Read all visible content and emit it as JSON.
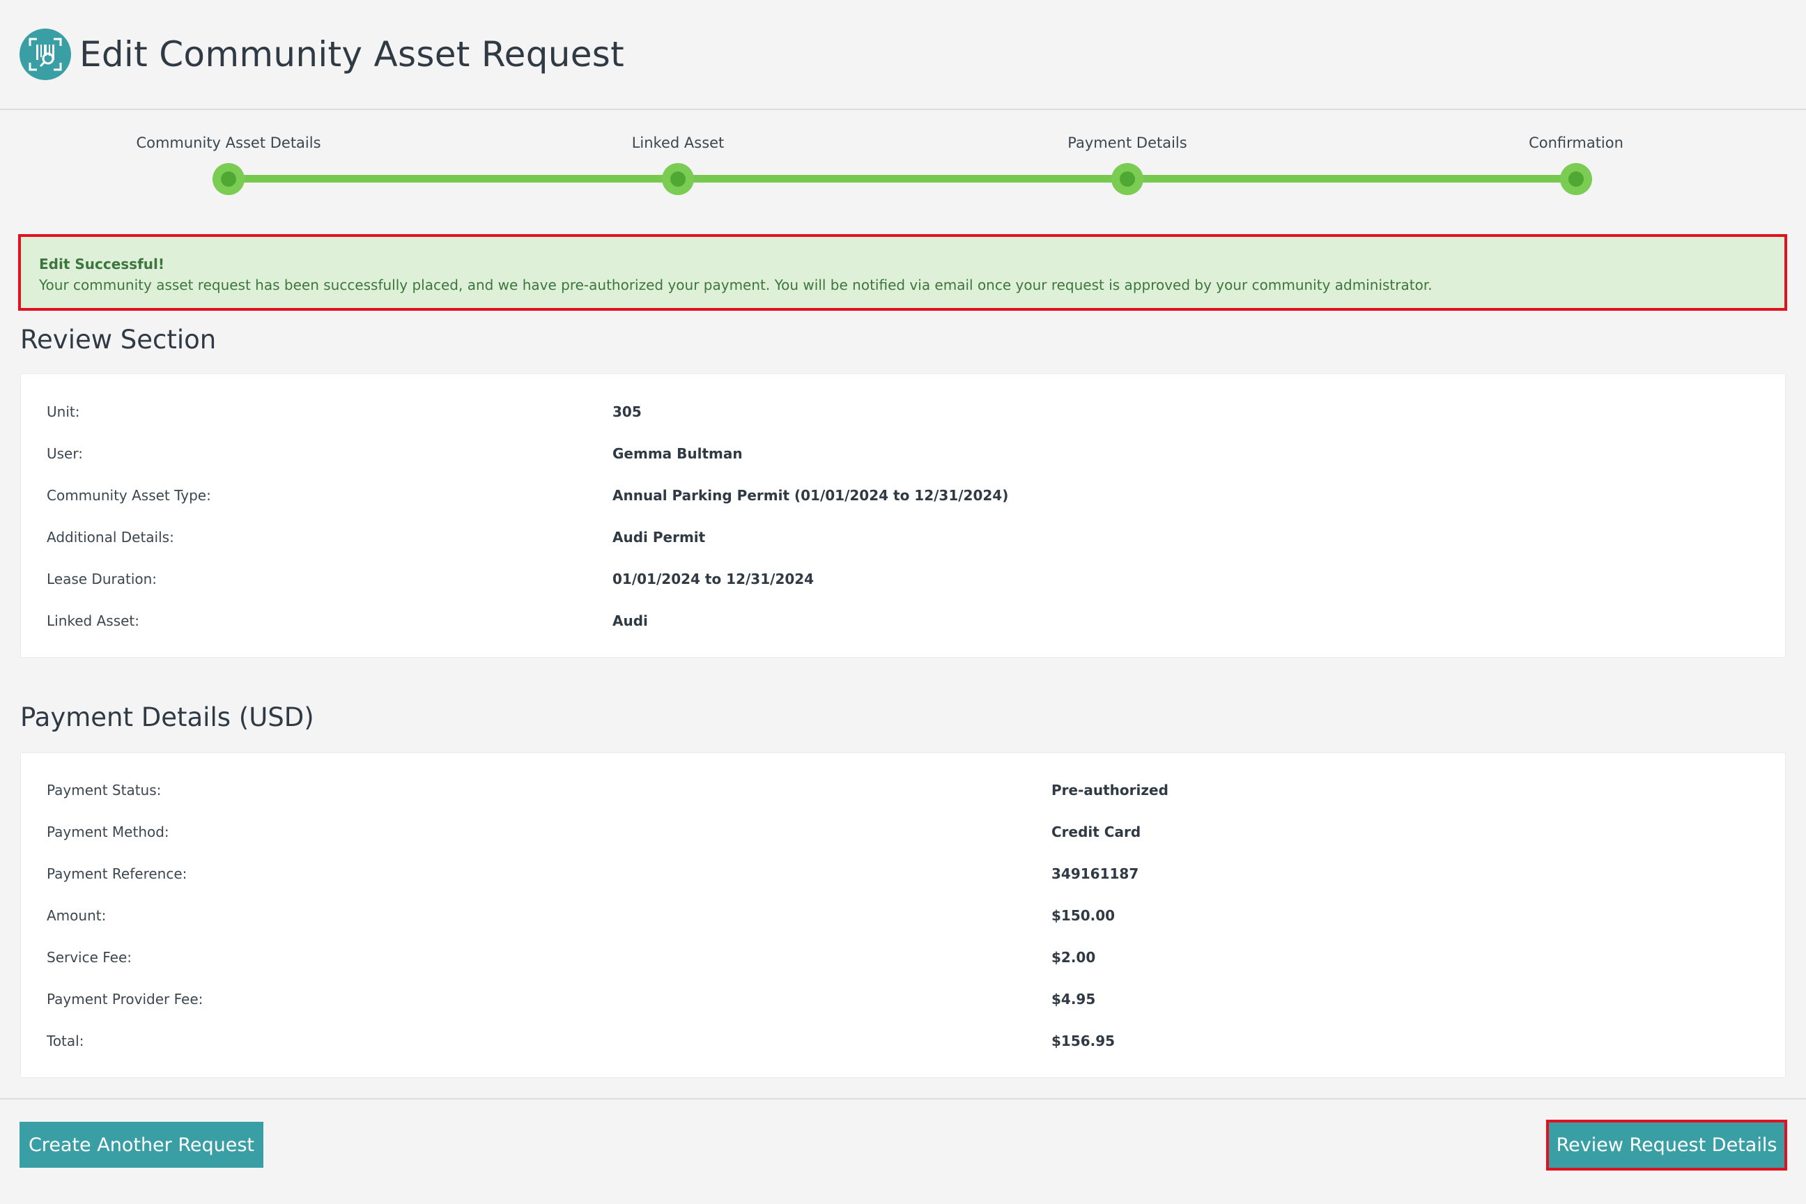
{
  "header": {
    "title": "Edit Community Asset Request",
    "logo_icon": "barcode-scan-icon"
  },
  "stepper": {
    "steps": [
      {
        "label": "Community Asset Details"
      },
      {
        "label": "Linked Asset"
      },
      {
        "label": "Payment Details"
      },
      {
        "label": "Confirmation"
      }
    ],
    "color": "#76c84f"
  },
  "alert": {
    "title": "Edit Successful!",
    "message": "Your community asset request has been successfully placed, and we have pre-authorized your payment. You will be notified via email once your request is approved by your community administrator."
  },
  "review": {
    "title": "Review Section",
    "rows": [
      {
        "label": "Unit:",
        "value": "305"
      },
      {
        "label": "User:",
        "value": "Gemma Bultman"
      },
      {
        "label": "Community Asset Type:",
        "value": "Annual Parking Permit (01/01/2024 to 12/31/2024)"
      },
      {
        "label": "Additional Details:",
        "value": "Audi Permit"
      },
      {
        "label": "Lease Duration:",
        "value": "01/01/2024 to 12/31/2024"
      },
      {
        "label": "Linked Asset:",
        "value": "Audi"
      }
    ]
  },
  "payment": {
    "title": "Payment Details (USD)",
    "rows": [
      {
        "label": "Payment Status:",
        "value": "Pre-authorized"
      },
      {
        "label": "Payment Method:",
        "value": "Credit Card"
      },
      {
        "label": "Payment Reference:",
        "value": "349161187"
      },
      {
        "label": "Amount:",
        "value": "$150.00"
      },
      {
        "label": "Service Fee:",
        "value": "$2.00"
      },
      {
        "label": "Payment Provider Fee:",
        "value": "$4.95"
      },
      {
        "label": "Total:",
        "value": "$156.95"
      }
    ]
  },
  "actions": {
    "create_label": "Create Another Request",
    "review_label": "Review Request Details"
  },
  "colors": {
    "accent": "#3a9ea5",
    "success_bg": "#dff0d8",
    "highlight": "#e0121f"
  }
}
